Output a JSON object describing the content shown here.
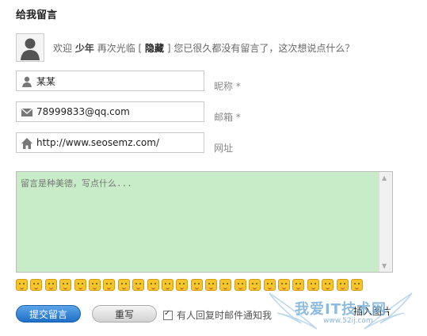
{
  "form_title": "给我留言",
  "welcome": {
    "prefix": "欢迎",
    "username": "少年",
    "middle": "再次光临 [",
    "hide_link": "隐藏",
    "suffix": "] 您已很久都没有留言了，这次想说点什么？"
  },
  "fields": {
    "name": {
      "value": "某某",
      "label": "昵称 *",
      "icon": "user-icon"
    },
    "email": {
      "value": "78999833@qq.com",
      "label": "邮箱 *",
      "icon": "mail-icon"
    },
    "website": {
      "value": "http://www.seosemz.com/",
      "label": "网址",
      "icon": "home-icon"
    }
  },
  "comment": {
    "placeholder": "留言是种美德，写点什么..."
  },
  "smiley_count": 24,
  "buttons": {
    "submit": "提交留言",
    "reset": "重写"
  },
  "notify_label": "有人回复时邮件通知我",
  "notify_checked": true,
  "insert_image": "插入图片",
  "watermark": {
    "text": "我爱IT技术网",
    "url": "www.52ij.com"
  },
  "colors": {
    "comment_bg": "#c8ecc8",
    "submit_blue": "#1e6fc7"
  }
}
